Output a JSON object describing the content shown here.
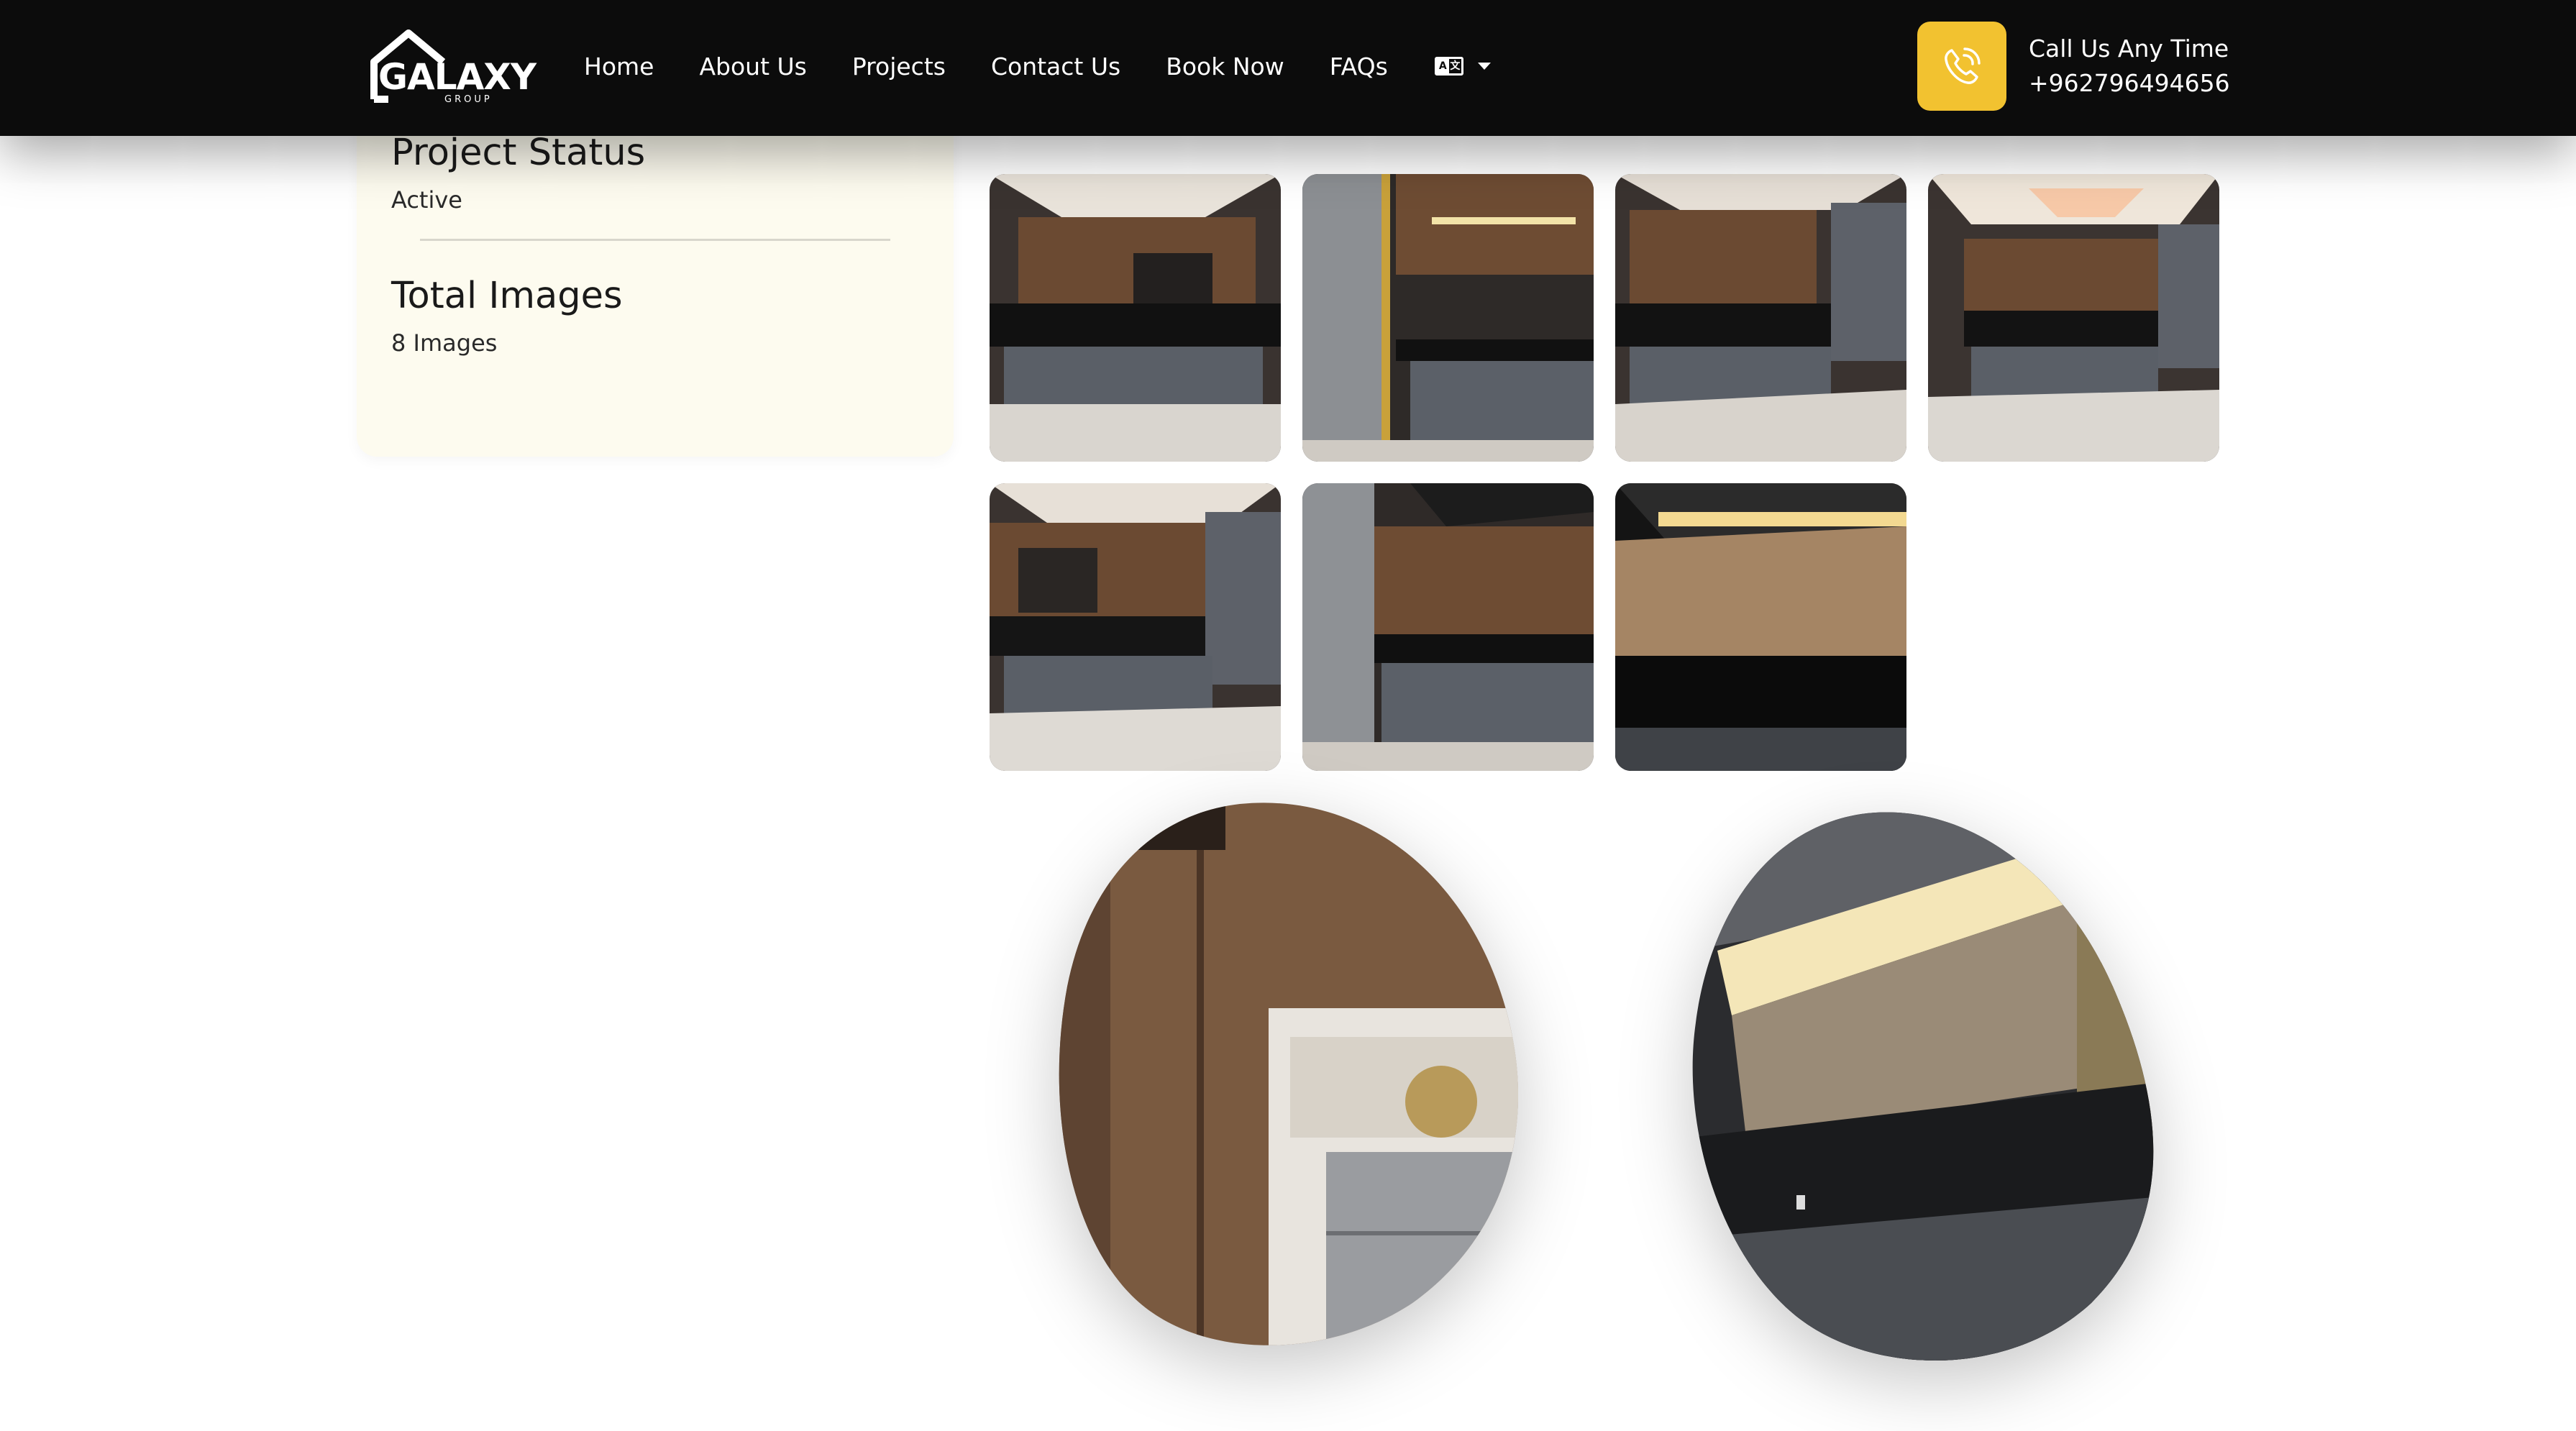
{
  "header": {
    "logo": {
      "word": "GALAXY",
      "sub": "GROUP"
    },
    "nav": [
      {
        "label": "Home"
      },
      {
        "label": "About Us"
      },
      {
        "label": "Projects"
      },
      {
        "label": "Contact Us"
      },
      {
        "label": "Book Now"
      },
      {
        "label": "FAQs"
      }
    ],
    "language_icon": "language-icon",
    "call": {
      "label": "Call Us Any Time",
      "number": "+962796494656",
      "icon": "phone-icon"
    }
  },
  "project_info": {
    "status_title": "Project Status",
    "status_value": "Active",
    "images_title": "Total Images",
    "images_value": "8 Images"
  },
  "gallery": {
    "thumbnails": [
      {
        "alt": "kitchen-photo-1"
      },
      {
        "alt": "kitchen-photo-2"
      },
      {
        "alt": "kitchen-photo-3"
      },
      {
        "alt": "kitchen-photo-4"
      },
      {
        "alt": "kitchen-photo-5"
      },
      {
        "alt": "kitchen-photo-6"
      },
      {
        "alt": "kitchen-photo-7"
      }
    ],
    "featured": [
      {
        "alt": "featured-kitchen-photo-1"
      },
      {
        "alt": "featured-kitchen-photo-2"
      }
    ]
  },
  "colors": {
    "header_bg": "#0c0c0c",
    "accent": "#f2c230",
    "card_bg": "#fdfbef"
  }
}
